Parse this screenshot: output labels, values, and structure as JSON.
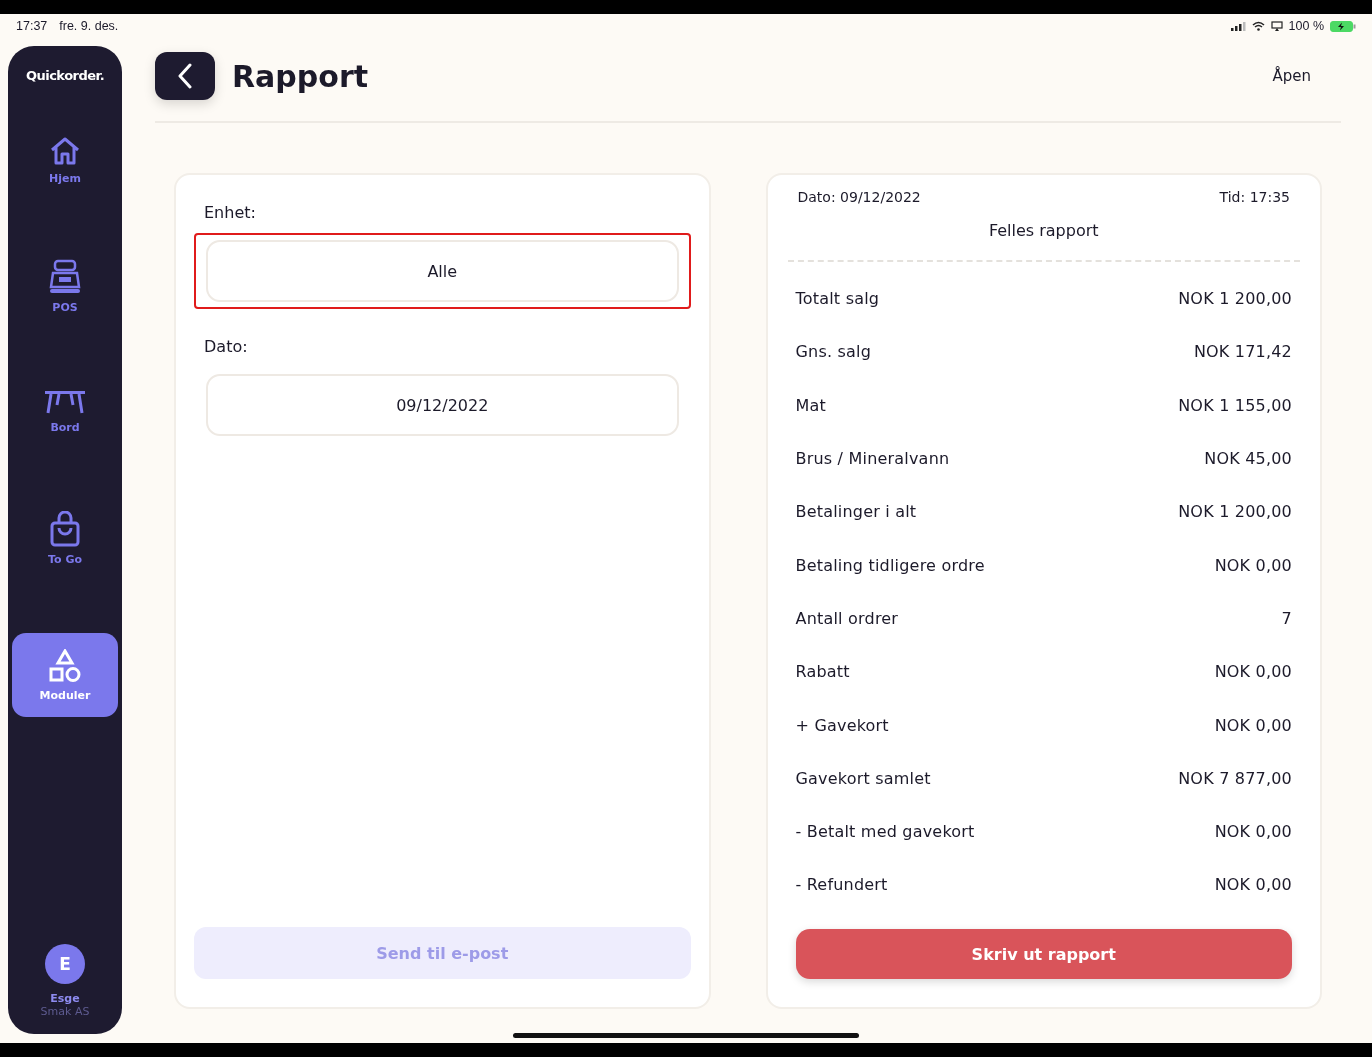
{
  "status_bar": {
    "time": "17:37",
    "date": "fre. 9. des.",
    "battery": "100 %"
  },
  "sidebar": {
    "logo": "Quickorder.",
    "items": [
      {
        "label": "Hjem",
        "selected": false
      },
      {
        "label": "POS",
        "selected": false
      },
      {
        "label": "Bord",
        "selected": false
      },
      {
        "label": "To Go",
        "selected": false
      },
      {
        "label": "Moduler",
        "selected": true
      }
    ],
    "user": {
      "initial": "E",
      "name": "Esge",
      "company": "Smak AS"
    }
  },
  "header": {
    "title": "Rapport",
    "status": "Åpen"
  },
  "filters": {
    "fields": [
      {
        "label": "Enhet:",
        "value": "Alle",
        "highlighted": true
      },
      {
        "label": "Dato:",
        "value": "09/12/2022",
        "highlighted": false
      }
    ],
    "email_button": {
      "label": "Send til e-post",
      "disabled": true
    }
  },
  "report": {
    "date": "Dato: 09/12/2022",
    "time": "Tid: 17:35",
    "title": "Felles rapport",
    "rows": [
      {
        "label": "Totalt salg",
        "value": "NOK 1 200,00"
      },
      {
        "label": "Gns. salg",
        "value": "NOK 171,42"
      },
      {
        "label": "Mat",
        "value": "NOK 1 155,00"
      },
      {
        "label": "Brus / Mineralvann",
        "value": "NOK 45,00"
      },
      {
        "label": "Betalinger i alt",
        "value": "NOK 1 200,00"
      },
      {
        "label": "Betaling tidligere ordre",
        "value": "NOK 0,00"
      },
      {
        "label": "Antall ordrer",
        "value": "7"
      },
      {
        "label": "Rabatt",
        "value": "NOK 0,00"
      },
      {
        "label": "+ Gavekort",
        "value": "NOK 0,00"
      },
      {
        "label": "Gavekort samlet",
        "value": "NOK 7 877,00"
      },
      {
        "label": "- Betalt med gavekort",
        "value": "NOK 0,00"
      },
      {
        "label": "- Refundert",
        "value": "NOK 0,00"
      }
    ],
    "print_button": "Skriv ut rapport"
  }
}
